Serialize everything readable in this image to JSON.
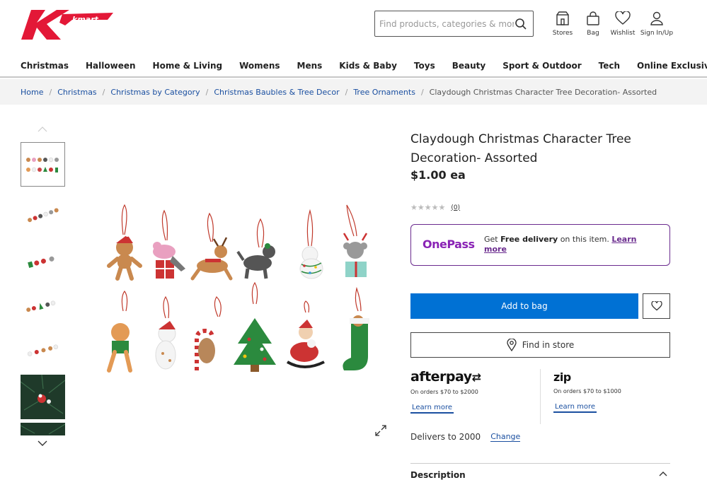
{
  "colors": {
    "brand_red": "#e31837",
    "primary_blue": "#0071d4",
    "onepass_purple": "#8a23b5",
    "link_blue": "#1a4fa0"
  },
  "header": {
    "logo_text": "kmart",
    "search": {
      "placeholder": "Find products, categories & more",
      "value": ""
    },
    "icons": [
      {
        "name": "store-icon",
        "label": "Stores"
      },
      {
        "name": "bag-icon",
        "label": "Bag"
      },
      {
        "name": "heart-icon",
        "label": "Wishlist"
      },
      {
        "name": "user-icon",
        "label": "Sign In/Up"
      }
    ]
  },
  "nav": [
    "Christmas",
    "Halloween",
    "Home & Living",
    "Womens",
    "Mens",
    "Kids & Baby",
    "Toys",
    "Beauty",
    "Sport & Outdoor",
    "Tech",
    "Online Exclusives"
  ],
  "breadcrumb": {
    "links": [
      "Home",
      "Christmas",
      "Christmas by Category",
      "Christmas Baubles & Tree Decor",
      "Tree Ornaments"
    ],
    "current": "Claydough Christmas Character Tree Decoration- Assorted"
  },
  "gallery": {
    "thumbnail_count": 7,
    "selected_index": 0
  },
  "product": {
    "title": "Claydough Christmas Character Tree Decoration- Assorted",
    "price": "$1.00",
    "price_unit": "ea",
    "rating": 0,
    "rating_count": "(0)"
  },
  "onepass": {
    "logo": "OnePass",
    "text_pre": "Get ",
    "text_bold": "Free delivery",
    "text_post": " on this item.",
    "link": "Learn more"
  },
  "actions": {
    "add_to_bag": "Add to bag",
    "find_in_store": "Find in store"
  },
  "afterpay": {
    "logo": "afterpay",
    "note": "On orders $70 to $2000",
    "link": "Learn more"
  },
  "zip": {
    "logo": "zip",
    "note": "On orders $70 to $1000",
    "link": "Learn more"
  },
  "delivery": {
    "text": "Delivers to 2000",
    "change": "Change"
  },
  "description": {
    "label": "Description"
  }
}
